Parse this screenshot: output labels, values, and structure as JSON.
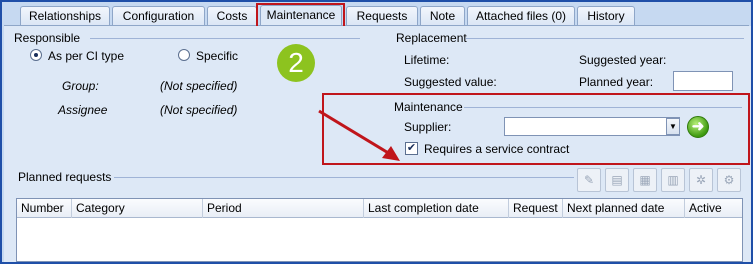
{
  "tabs": [
    {
      "label": "Relationships",
      "active": false
    },
    {
      "label": "Configuration",
      "active": false
    },
    {
      "label": "Costs",
      "active": false
    },
    {
      "label": "Maintenance",
      "active": true
    },
    {
      "label": "Requests",
      "active": false
    },
    {
      "label": "Note",
      "active": false
    },
    {
      "label": "Attached files (0)",
      "active": false
    },
    {
      "label": "History",
      "active": false
    }
  ],
  "responsible": {
    "title": "Responsible",
    "option_as_per": "As per CI type",
    "option_specific": "Specific",
    "selected": "As per CI type",
    "group_label": "Group:",
    "group_value": "(Not specified)",
    "assignee_label": "Assignee",
    "assignee_value": "(Not specified)"
  },
  "step_badge": "2",
  "replacement": {
    "title": "Replacement",
    "lifetime_label": "Lifetime:",
    "suggested_value_label": "Suggested value:",
    "suggested_year_label": "Suggested year:",
    "planned_year_label": "Planned year:",
    "planned_year_value": ""
  },
  "maintenance": {
    "title": "Maintenance",
    "supplier_label": "Supplier:",
    "supplier_value": "",
    "requires_contract_label": "Requires a service contract",
    "requires_contract_checked": true
  },
  "planned_requests": {
    "title": "Planned requests",
    "toolbar_icons": [
      "edit-icon",
      "new-document-icon",
      "open-icon",
      "save-icon",
      "settings-icon",
      "gear-icon"
    ],
    "columns": [
      "Number",
      "Category",
      "Period",
      "Last completion date",
      "Request",
      "Next planned date",
      "Active"
    ]
  },
  "colors": {
    "highlight": "#c0151b",
    "frame": "#1f4fa8",
    "badge": "#8dc31f"
  }
}
